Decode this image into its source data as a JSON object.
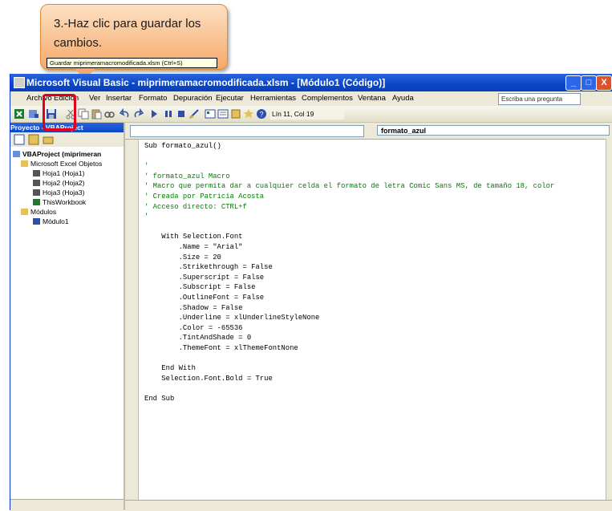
{
  "callout": {
    "text": "3.-Haz clic para guardar los cambios."
  },
  "window": {
    "title": "Microsoft Visual Basic - miprimeramacromodificada.xlsm - [Módulo1 (Código)]",
    "min_glyph": "_",
    "max_glyph": "□",
    "close_glyph": "X"
  },
  "menu": {
    "items": [
      "Archivo",
      "Edición",
      "Ver",
      "Insertar",
      "Formato",
      "Depuración",
      "Ejecutar",
      "Herramientas",
      "Complementos",
      "Ventana",
      "Ayuda"
    ],
    "ask_placeholder": "Escriba una pregunta"
  },
  "toolbar": {
    "position": "Lín 11, Col 19",
    "save_tooltip": "Guardar miprimeramacromodificada.xlsm (Ctrl+S)"
  },
  "project": {
    "title": "Proyecto - VBAProject",
    "root": "VBAProject (miprimeran",
    "excel_objects": "Microsoft Excel Objetos",
    "sheets": [
      "Hoja1 (Hoja1)",
      "Hoja2 (Hoja2)",
      "Hoja3 (Hoja3)",
      "ThisWorkbook"
    ],
    "modules": "Módulos",
    "module1": "Módulo1"
  },
  "code": {
    "procedure_combo": "formato_azul",
    "lines": [
      {
        "t": "Sub formato_azul()",
        "c": false
      },
      {
        "t": "",
        "c": false
      },
      {
        "t": "'",
        "c": true
      },
      {
        "t": "' formato_azul Macro",
        "c": true
      },
      {
        "t": "' Macro que permita dar a cualquier celda el formato de letra Comic Sans MS, de tamaño 18, color",
        "c": true
      },
      {
        "t": "' Creada por Patricia Acosta",
        "c": true
      },
      {
        "t": "' Acceso directo: CTRL+f",
        "c": true
      },
      {
        "t": "'",
        "c": true
      },
      {
        "t": "",
        "c": false
      },
      {
        "t": "    With Selection.Font",
        "c": false
      },
      {
        "t": "        .Name = \"Arial\"",
        "c": false
      },
      {
        "t": "        .Size = 20",
        "c": false
      },
      {
        "t": "        .Strikethrough = False",
        "c": false
      },
      {
        "t": "        .Superscript = False",
        "c": false
      },
      {
        "t": "        .Subscript = False",
        "c": false
      },
      {
        "t": "        .OutlineFont = False",
        "c": false
      },
      {
        "t": "        .Shadow = False",
        "c": false
      },
      {
        "t": "        .Underline = xlUnderlineStyleNone",
        "c": false
      },
      {
        "t": "        .Color = -65536",
        "c": false
      },
      {
        "t": "        .TintAndShade = 0",
        "c": false
      },
      {
        "t": "        .ThemeFont = xlThemeFontNone",
        "c": false
      },
      {
        "t": "",
        "c": false
      },
      {
        "t": "    End With",
        "c": false
      },
      {
        "t": "    Selection.Font.Bold = True",
        "c": false
      },
      {
        "t": "",
        "c": false
      },
      {
        "t": "End Sub",
        "c": false
      }
    ]
  }
}
